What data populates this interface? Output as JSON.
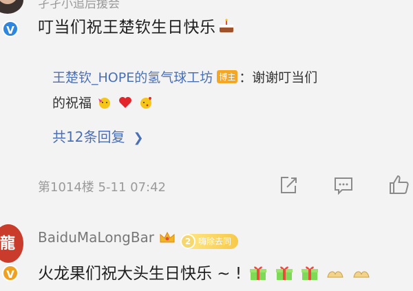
{
  "comment1": {
    "author_partial": "孑孑小追后援会",
    "text": "叮当们祝王楚钦生日快乐",
    "text_emoji": "cake",
    "reply": {
      "author": "王楚钦_HOPE的氢气球工坊",
      "badge": "博主",
      "text_line1": "：谢谢叮当们",
      "text_line2": "的祝福",
      "emojis": [
        "party-face",
        "heart",
        "kiss-face"
      ]
    },
    "more_replies": "共12条回复",
    "floor": "第1014楼",
    "date": "5-11",
    "time": "07:42"
  },
  "comment2": {
    "author": "BaiduMaLongBar",
    "fan_level": "2",
    "fan_badge": "嗨除去同",
    "avatar_text": "龍",
    "text": "火龙果们祝大头生日快乐 ~ !",
    "emojis": [
      "gift",
      "gift",
      "gift",
      "fortune-cookie",
      "fortune-cookie"
    ]
  },
  "colors": {
    "link": "#4a6fb5",
    "muted": "#9a9a9a",
    "host_badge": "#f5a623",
    "verified": "#2e86de"
  }
}
